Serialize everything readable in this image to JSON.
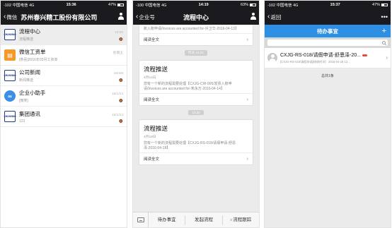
{
  "phone1": {
    "status": {
      "carrier": "-102 中国电信 4G",
      "time": "15:36",
      "battery": "47%"
    },
    "nav": {
      "back": "微信",
      "title": "苏州春兴精工股份有限公司"
    },
    "chats": [
      {
        "name": "流程中心",
        "time": "13:32",
        "sub": "流程推送",
        "mute": "🔕",
        "avatar": "CHUNXING"
      },
      {
        "name": "微信工资单",
        "time": "星期五",
        "sub": "[恭喜]2016年03月工资单",
        "mute": "",
        "avatar": "▤"
      },
      {
        "name": "公司新闻",
        "time": "16/3/8",
        "sub": "新闻推送",
        "mute": "🔕",
        "avatar": "CHUNXING"
      },
      {
        "name": "企业小助手",
        "time": "16/1/14",
        "sub": "[微笑]",
        "mute": "🔕",
        "avatar": "∞"
      },
      {
        "name": "集团通讯",
        "time": "16/1/14",
        "sub": "123",
        "mute": "🔕",
        "avatar": "CHUNXING"
      }
    ]
  },
  "phone2": {
    "status": {
      "carrier": "-100 中国电信 4G",
      "time": "14:19",
      "battery": "63%"
    },
    "nav": {
      "back": "企业号",
      "title": "流程中心"
    },
    "partial_card": {
      "text": "账入账申请/Invoices are accounted for-许卫华-2016-04-13】",
      "footer": "阅读全文"
    },
    "pill1": "昨天 14:21",
    "card1": {
      "title": "流程推送",
      "date": "4月14日",
      "text": "您有一个新的流程需要处理【CXJG-CW-005/发票入账申请/Invoices are accounted for-朱永方-2016-04-14】",
      "footer": "阅读全文"
    },
    "pill2": "13:32",
    "card2": {
      "title": "流程推送",
      "date": "4月18日",
      "text": "您有一个新的流程需要处理【CXJG-RS-018/请假申请-舒恩泽-2016-04-18】",
      "footer": "阅读全文"
    },
    "tabs": {
      "todo": "待办事宜",
      "start": "发起流程",
      "track": "流程跟踪",
      "menu_glyph": "≡"
    }
  },
  "phone3": {
    "status": {
      "carrier": "-102 中国电信 4G",
      "time": "15:37",
      "battery": "47%"
    },
    "nav": {
      "back": "返回",
      "more": "•••"
    },
    "header": {
      "title": "待办事宜",
      "plus": "+"
    },
    "todo": {
      "title": "CXJG-RS-018/请假申请-舒恩泽-20...",
      "meta": "[CXJG-RS-018/请假申请]接收时间：2016-04-18 13..."
    },
    "total": "总共1条"
  },
  "colors": {
    "header_blue": "#2c8fe4",
    "nav_dark": "#1b1b1f",
    "badge_red": "#e84a3b"
  }
}
